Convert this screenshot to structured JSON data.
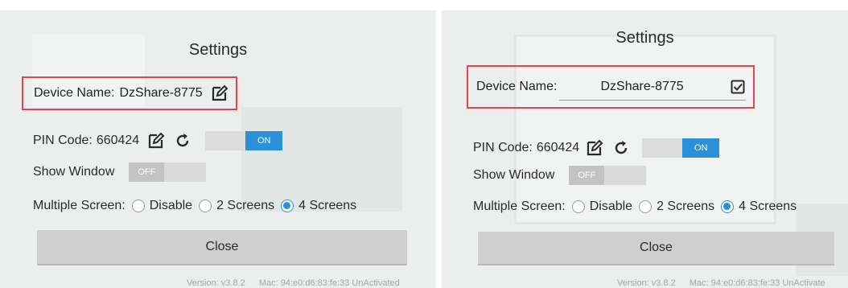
{
  "left": {
    "title": "Settings",
    "device_name_label": "Device Name:",
    "device_name_value": "DzShare-8775",
    "pin_label": "PIN Code:",
    "pin_value": "660424",
    "pin_toggle": "ON",
    "show_window_label": "Show Window",
    "show_window_toggle": "OFF",
    "multi_label": "Multiple Screen:",
    "options": [
      "Disable",
      "2 Screens",
      "4 Screens"
    ],
    "selected_option": "4 Screens",
    "close_label": "Close",
    "version": "Version: v3.8.2",
    "mac": "Mac: 94:e0:d6:83:fe:33 UnActivated"
  },
  "right": {
    "title": "Settings",
    "device_name_label": "Device Name:",
    "device_name_value": "DzShare-8775",
    "pin_label": "PIN Code:",
    "pin_value": "660424",
    "pin_toggle": "ON",
    "show_window_label": "Show Window",
    "show_window_toggle": "OFF",
    "multi_label": "Multiple Screen:",
    "options": [
      "Disable",
      "2 Screens",
      "4 Screens"
    ],
    "selected_option": "4 Screens",
    "close_label": "Close",
    "version": "Version: v3.8.2",
    "mac": "Mac: 94:e0:d6:83:fe:33 UnActivate"
  },
  "colors": {
    "accent": "#2a90d8",
    "highlight_box": "#e0474c",
    "button_bg": "#cfcfcf"
  },
  "icons": [
    "edit-icon",
    "refresh-icon",
    "checkbox-checked-icon"
  ]
}
